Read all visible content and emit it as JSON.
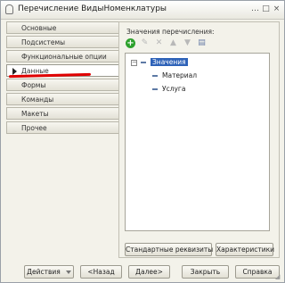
{
  "window": {
    "title": "Перечисление ВидыНоменклатуры",
    "controls": [
      "…",
      "□",
      "×"
    ]
  },
  "tabs": [
    {
      "label": "Основные",
      "active": false
    },
    {
      "label": "Подсистемы",
      "active": false
    },
    {
      "label": "Функциональные опции",
      "active": false
    },
    {
      "label": "Данные",
      "active": true
    },
    {
      "label": "Формы",
      "active": false
    },
    {
      "label": "Команды",
      "active": false
    },
    {
      "label": "Макеты",
      "active": false
    },
    {
      "label": "Прочее",
      "active": false
    }
  ],
  "panel": {
    "label": "Значения перечисления:",
    "tree": {
      "root": "Значения",
      "items": [
        "Материал",
        "Услуга"
      ]
    },
    "buttons": {
      "standard_attributes": "Стандартные реквизиты",
      "characteristics": "Характеристики"
    }
  },
  "footer": {
    "actions": "Действия",
    "back": "<Назад",
    "next": "Далее>",
    "close": "Закрыть",
    "help": "Справка"
  },
  "colors": {
    "accent_selection": "#2e62b8",
    "add_button": "#2da12d",
    "annotation_underline": "#e00000"
  }
}
